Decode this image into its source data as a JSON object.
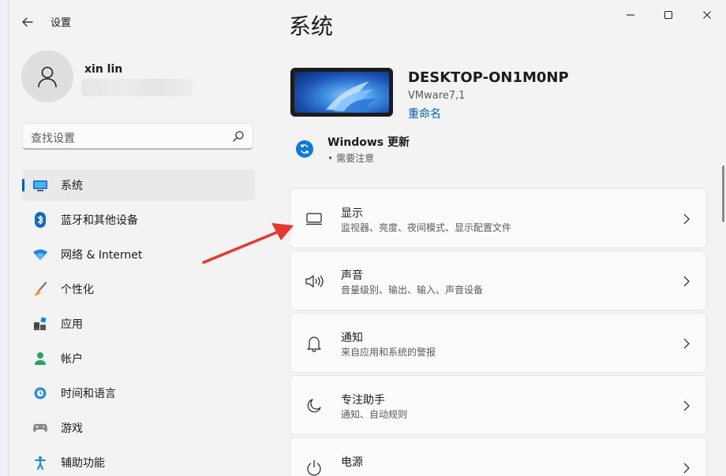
{
  "app": {
    "title": "设置",
    "user_name": "xin lin"
  },
  "search": {
    "placeholder": "查找设置"
  },
  "sidebar": {
    "items": [
      {
        "label": "系统",
        "icon": "monitor-icon",
        "active": true
      },
      {
        "label": "蓝牙和其他设备",
        "icon": "bluetooth-icon"
      },
      {
        "label": "网络 & Internet",
        "icon": "wifi-icon"
      },
      {
        "label": "个性化",
        "icon": "brush-icon"
      },
      {
        "label": "应用",
        "icon": "apps-icon"
      },
      {
        "label": "帐户",
        "icon": "person-icon"
      },
      {
        "label": "时间和语言",
        "icon": "globe-clock-icon"
      },
      {
        "label": "游戏",
        "icon": "gamepad-icon"
      },
      {
        "label": "辅助功能",
        "icon": "accessibility-icon"
      }
    ]
  },
  "main": {
    "title": "系统",
    "device": {
      "name": "DESKTOP-ON1M0NP",
      "model": "VMware7,1",
      "rename_label": "重命名"
    },
    "update": {
      "title": "Windows 更新",
      "status": "需要注意"
    },
    "cards": [
      {
        "title": "显示",
        "subtitle": "监视器、亮度、夜间模式、显示配置文件",
        "icon": "display-icon"
      },
      {
        "title": "声音",
        "subtitle": "音量级别、输出、输入、声音设备",
        "icon": "speaker-icon"
      },
      {
        "title": "通知",
        "subtitle": "来自应用和系统的警报",
        "icon": "bell-icon"
      },
      {
        "title": "专注助手",
        "subtitle": "通知、自动规则",
        "icon": "moon-icon"
      },
      {
        "title": "电源",
        "subtitle": "",
        "icon": "power-icon"
      }
    ]
  },
  "colors": {
    "accent": "#005fb8",
    "annotation_arrow": "#e8382f"
  }
}
